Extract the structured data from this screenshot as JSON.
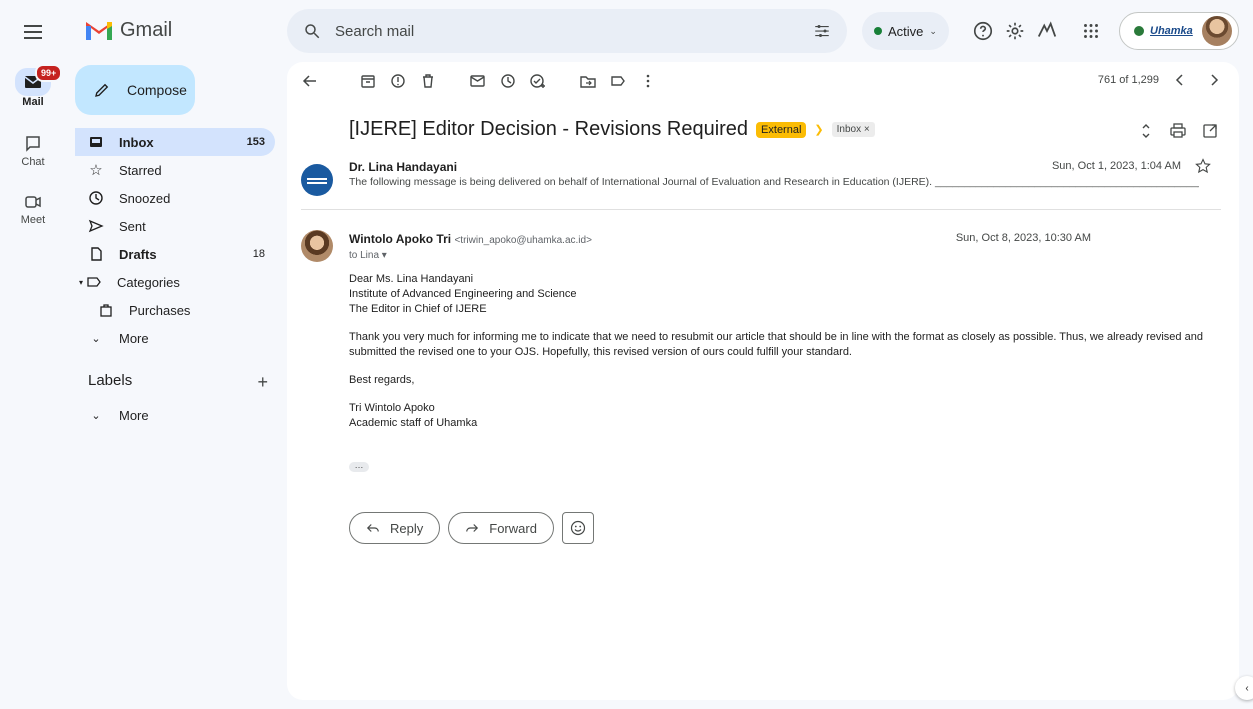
{
  "app": {
    "name": "Gmail"
  },
  "rail": {
    "mail_label": "Mail",
    "mail_badge": "99+",
    "chat_label": "Chat",
    "meet_label": "Meet"
  },
  "search": {
    "placeholder": "Search mail"
  },
  "status": {
    "label": "Active"
  },
  "account": {
    "org_label": "Uhamka"
  },
  "nav": {
    "compose_label": "Compose",
    "items": [
      {
        "label": "Inbox",
        "count": "153"
      },
      {
        "label": "Starred",
        "count": ""
      },
      {
        "label": "Snoozed",
        "count": ""
      },
      {
        "label": "Sent",
        "count": ""
      },
      {
        "label": "Drafts",
        "count": "18"
      },
      {
        "label": "Categories",
        "count": ""
      },
      {
        "label": "Purchases",
        "count": ""
      },
      {
        "label": "More",
        "count": ""
      }
    ],
    "labels_header": "Labels",
    "labels_more": "More"
  },
  "toolbar": {
    "pager_text": "761 of 1,299"
  },
  "thread": {
    "subject": "[IJERE] Editor Decision - Revisions Required",
    "tag_external": "External",
    "tag_inbox": "Inbox ×",
    "msg1": {
      "sender": "Dr. Lina Handayani",
      "snippet": "The following message is being delivered on behalf of International Journal of Evaluation and Research in Education (IJERE). ________________________________________________________________",
      "date": "Sun, Oct 1, 2023, 1:04 AM"
    },
    "msg2": {
      "sender": "Wintolo Apoko Tri",
      "email": "<triwin_apoko@uhamka.ac.id>",
      "to": "to Lina ▾",
      "date": "Sun, Oct 8, 2023, 10:30 AM",
      "body": {
        "greeting1": "Dear Ms. Lina Handayani",
        "greeting2": "Institute of Advanced Engineering and Science",
        "greeting3": "The Editor in Chief of IJERE",
        "paragraph": "Thank you very much for informing me to indicate that we need to resubmit our article that should be in line with the format as closely as possible. Thus, we already revised and submitted the revised one to your OJS. Hopefully, this revised version of ours could fulfill your standard.",
        "closing": "Best regards,",
        "sig1": "Tri Wintolo Apoko",
        "sig2": "Academic staff of Uhamka"
      }
    },
    "reply_label": "Reply",
    "forward_label": "Forward"
  }
}
